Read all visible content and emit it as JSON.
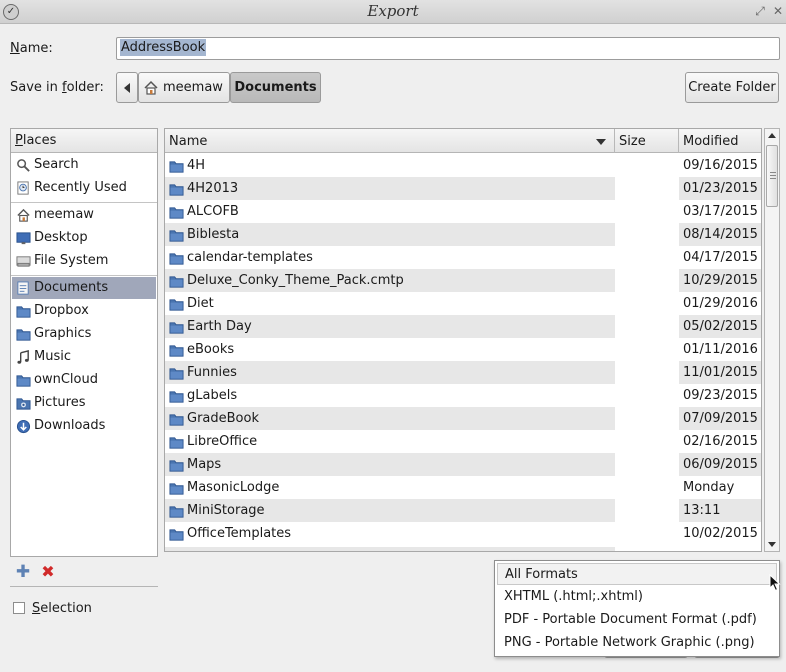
{
  "window": {
    "title": "Export"
  },
  "name_label": "Name:",
  "name_value": "AddressBook",
  "save_in_label": "Save in folder:",
  "breadcrumb": {
    "home": "meemaw",
    "current": "Documents"
  },
  "create_folder_label": "Create Folder",
  "places": {
    "header": "Places",
    "groups": [
      [
        {
          "label": "Search",
          "icon": "search-icon"
        },
        {
          "label": "Recently Used",
          "icon": "recent-icon"
        }
      ],
      [
        {
          "label": "meemaw",
          "icon": "home-icon"
        },
        {
          "label": "Desktop",
          "icon": "desktop-icon"
        },
        {
          "label": "File System",
          "icon": "drive-icon"
        }
      ],
      [
        {
          "label": "Documents",
          "icon": "documents-icon",
          "active": true
        },
        {
          "label": "Dropbox",
          "icon": "folder-icon"
        },
        {
          "label": "Graphics",
          "icon": "folder-icon"
        },
        {
          "label": "Music",
          "icon": "music-icon"
        },
        {
          "label": "ownCloud",
          "icon": "folder-icon"
        },
        {
          "label": "Pictures",
          "icon": "pictures-icon"
        },
        {
          "label": "Downloads",
          "icon": "downloads-icon"
        }
      ]
    ]
  },
  "files": {
    "columns": {
      "name": "Name",
      "size": "Size",
      "modified": "Modified"
    },
    "rows": [
      {
        "name": "4H",
        "modified": "09/16/2015"
      },
      {
        "name": "4H2013",
        "modified": "01/23/2015"
      },
      {
        "name": "ALCOFB",
        "modified": "03/17/2015"
      },
      {
        "name": "Biblesta",
        "modified": "08/14/2015"
      },
      {
        "name": "calendar-templates",
        "modified": "04/17/2015"
      },
      {
        "name": "Deluxe_Conky_Theme_Pack.cmtp",
        "modified": "10/29/2015"
      },
      {
        "name": "Diet",
        "modified": "01/29/2016"
      },
      {
        "name": "Earth Day",
        "modified": "05/02/2015"
      },
      {
        "name": "eBooks",
        "modified": "01/11/2016"
      },
      {
        "name": "Funnies",
        "modified": "11/01/2015"
      },
      {
        "name": "gLabels",
        "modified": "09/23/2015"
      },
      {
        "name": "GradeBook",
        "modified": "07/09/2015"
      },
      {
        "name": "LibreOffice",
        "modified": "02/16/2015"
      },
      {
        "name": "Maps",
        "modified": "06/09/2015"
      },
      {
        "name": "MasonicLodge",
        "modified": "Monday"
      },
      {
        "name": "MiniStorage",
        "modified": "13:11"
      },
      {
        "name": "OfficeTemplates",
        "modified": "10/02/2015"
      }
    ]
  },
  "selection_label": "Selection",
  "format_dropdown": {
    "options": [
      "All Formats",
      "XHTML (.html;.xhtml)",
      "PDF - Portable Document Format (.pdf)",
      "PNG - Portable Network Graphic (.png)"
    ],
    "selected_index": 0
  },
  "colors": {
    "folder": "#4a75b0",
    "selected_place": "#a0a7ba",
    "text_selection": "#a4b6d0"
  }
}
